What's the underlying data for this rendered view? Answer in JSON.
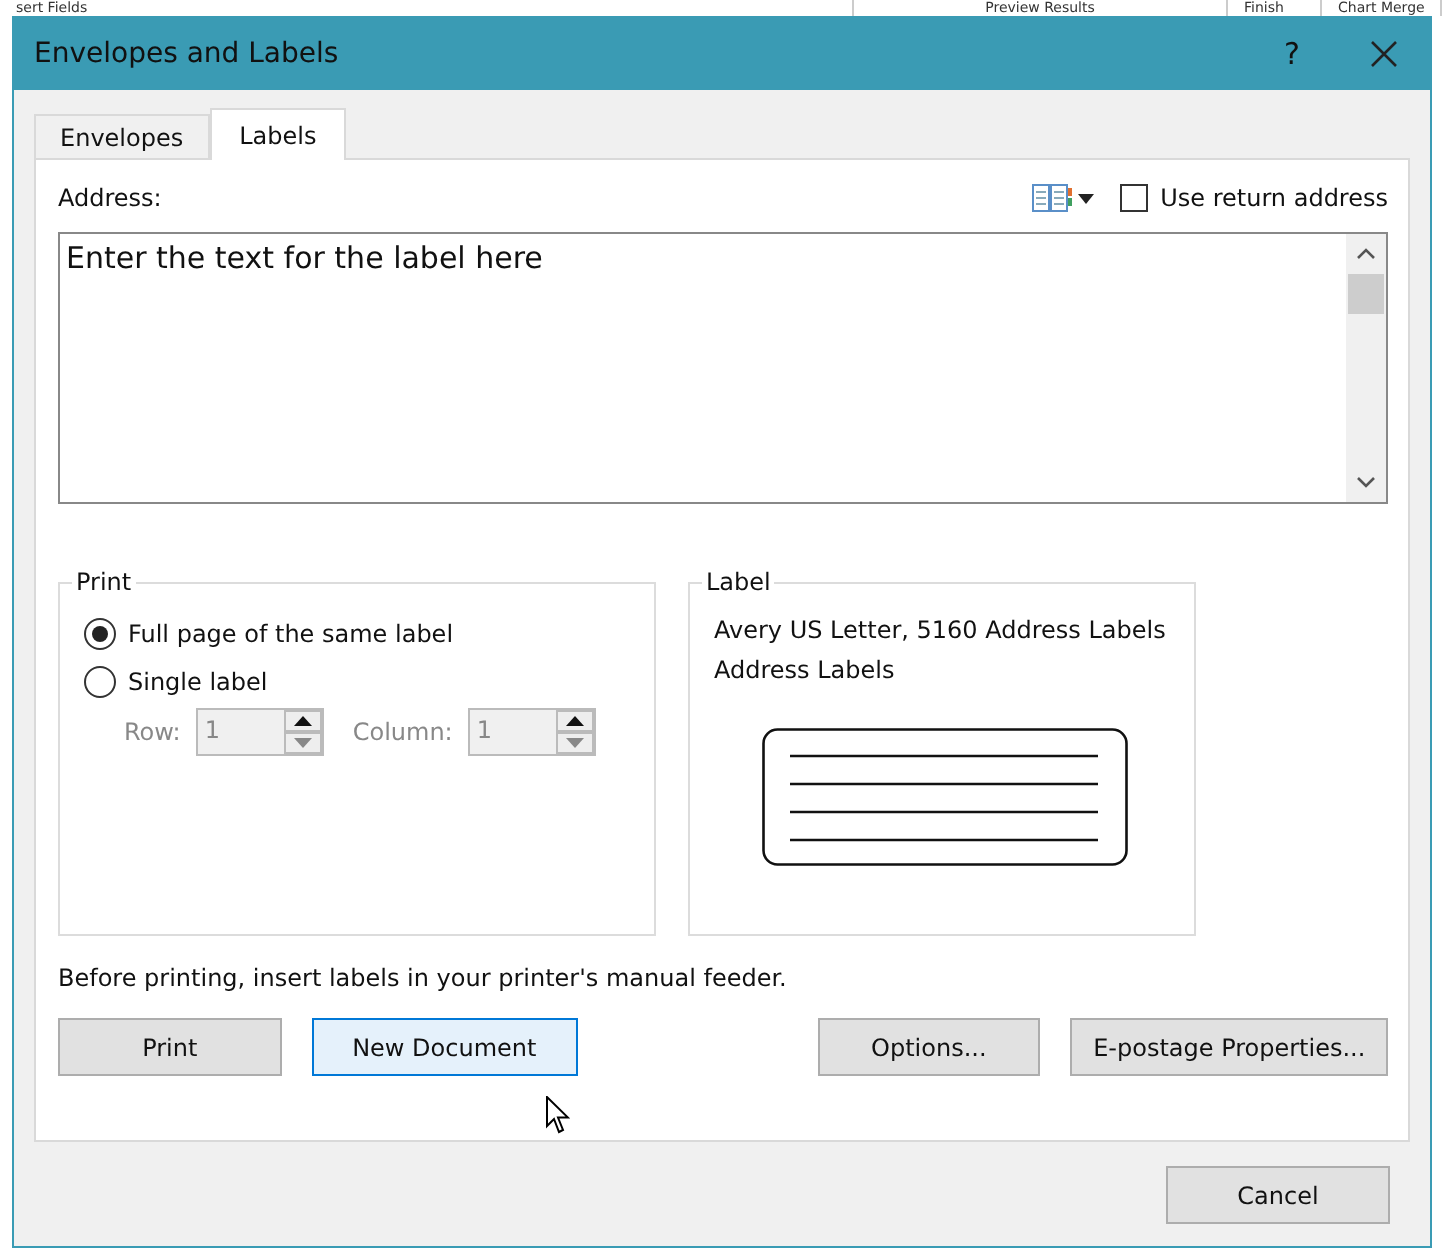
{
  "background_toolbar": [
    "sert Fields",
    "Preview Results",
    "Finish",
    "Chart Merge"
  ],
  "window": {
    "title": "Envelopes and Labels",
    "help": "?"
  },
  "tabs": [
    {
      "label": "Envelopes",
      "selected": false
    },
    {
      "label": "Labels",
      "selected": true
    }
  ],
  "address": {
    "label": "Address:",
    "value": "Enter the text for the label here",
    "use_return_address": {
      "label": "Use return address",
      "checked": false
    }
  },
  "print_group": {
    "title": "Print",
    "options": [
      {
        "label": "Full page of the same label",
        "selected": true
      },
      {
        "label": "Single label",
        "selected": false
      }
    ],
    "spinners": [
      {
        "label": "Row:",
        "value": "1",
        "disabled": true
      },
      {
        "label": "Column:",
        "value": "1",
        "disabled": true
      }
    ]
  },
  "label_group": {
    "title": "Label",
    "lines": [
      "Avery US Letter, 5160 Address Labels",
      "Address Labels"
    ]
  },
  "note": "Before printing, insert labels in your printer's manual feeder.",
  "buttons": [
    {
      "label": "Print",
      "hovered": false
    },
    {
      "label": "New Document",
      "hovered": true
    },
    {
      "label": "Options...",
      "hovered": false
    },
    {
      "label": "E-postage Properties...",
      "hovered": false
    }
  ],
  "cancel": "Cancel"
}
